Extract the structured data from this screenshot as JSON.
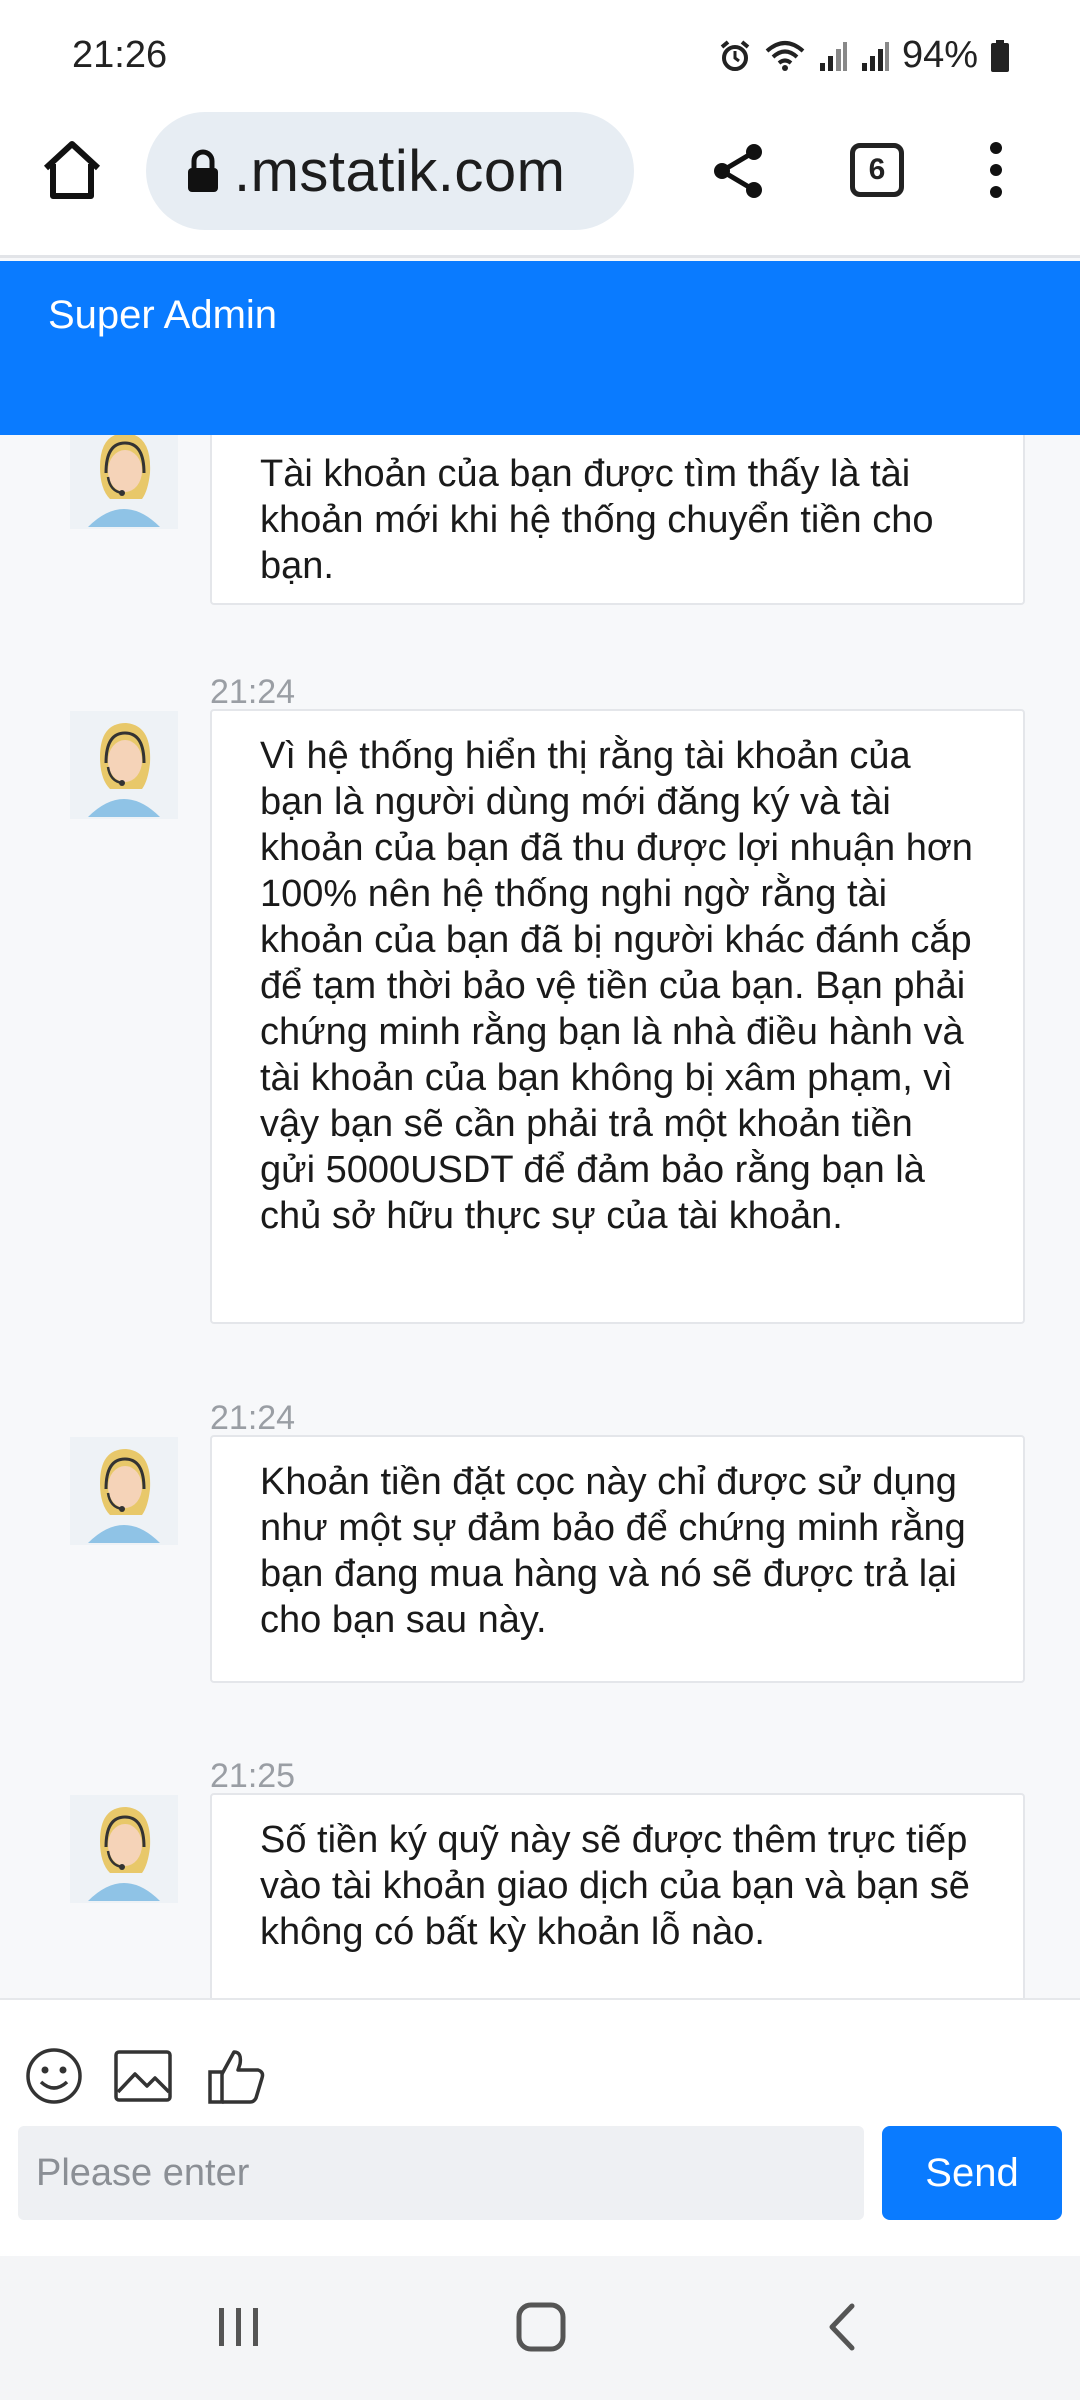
{
  "status_bar": {
    "time": "21:26",
    "battery": "94%"
  },
  "browser": {
    "url": ".mstatik.com",
    "tab_count": "6"
  },
  "chat": {
    "title": "Super Admin"
  },
  "messages": [
    {
      "time": "",
      "text": "Tài khoản của bạn được tìm thấy là tài khoản mới khi hệ thống chuyển tiền cho bạn."
    },
    {
      "time": "21:24",
      "text": "Vì hệ thống hiển thị rằng tài khoản của bạn là người dùng mới đăng ký và tài khoản của bạn đã thu được lợi nhuận hơn 100% nên hệ thống nghi ngờ rằng tài khoản của bạn đã bị người khác đánh cắp để tạm thời bảo vệ tiền của bạn. Bạn phải chứng minh rằng bạn là nhà điều hành và tài khoản của bạn không bị xâm phạm, vì vậy bạn sẽ cần phải trả một khoản tiền gửi 5000USDT để đảm bảo rằng bạn là chủ sở hữu thực sự của tài khoản."
    },
    {
      "time": "21:24",
      "text": "Khoản tiền đặt cọc này chỉ được sử dụng như một sự đảm bảo để chứng minh rằng bạn đang mua hàng và nó sẽ được trả lại cho bạn sau này."
    },
    {
      "time": "21:25",
      "text": "Số tiền ký quỹ này sẽ được thêm trực tiếp vào tài khoản giao dịch của bạn và bạn sẽ không có bất kỳ khoản lỗ nào."
    }
  ],
  "composer": {
    "placeholder": "Please enter",
    "send_label": "Send"
  },
  "colors": {
    "accent": "#0a7bff"
  },
  "icons": {
    "toolbar": [
      "emoji-icon",
      "image-icon",
      "thumbs-up-icon"
    ],
    "nav": [
      "recents-icon",
      "home-icon",
      "back-icon"
    ]
  }
}
